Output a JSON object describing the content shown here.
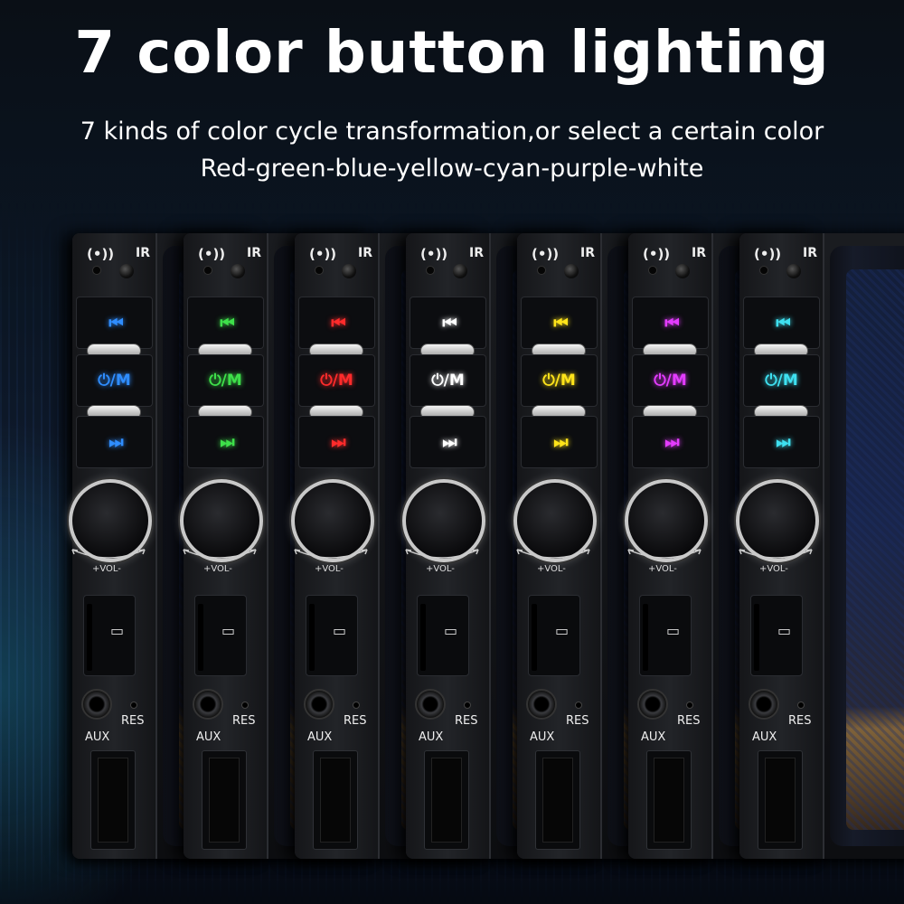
{
  "title": "7 color button lighting",
  "subtitle_line1": "7 kinds of color cycle transformation,or select a certain color",
  "subtitle_line2": "Red-green-blue-yellow-cyan-purple-white",
  "panel_labels": {
    "ir": "IR",
    "vol": "+VOL-",
    "res": "RES",
    "aux": "AUX",
    "prev_icon": "⏮",
    "next_icon": "⏭",
    "power_m": "⏻/M",
    "bluetooth_icon": "(•))",
    "sd_icon": "▭"
  },
  "units": [
    {
      "color_name": "blue",
      "button_color": "#2f8dff"
    },
    {
      "color_name": "green",
      "button_color": "#3ee04a"
    },
    {
      "color_name": "red",
      "button_color": "#ff2b2b"
    },
    {
      "color_name": "white",
      "button_color": "#ffffff"
    },
    {
      "color_name": "yellow",
      "button_color": "#ffe41a"
    },
    {
      "color_name": "purple",
      "button_color": "#e43cff"
    },
    {
      "color_name": "cyan",
      "button_color": "#3ee0f0"
    }
  ]
}
